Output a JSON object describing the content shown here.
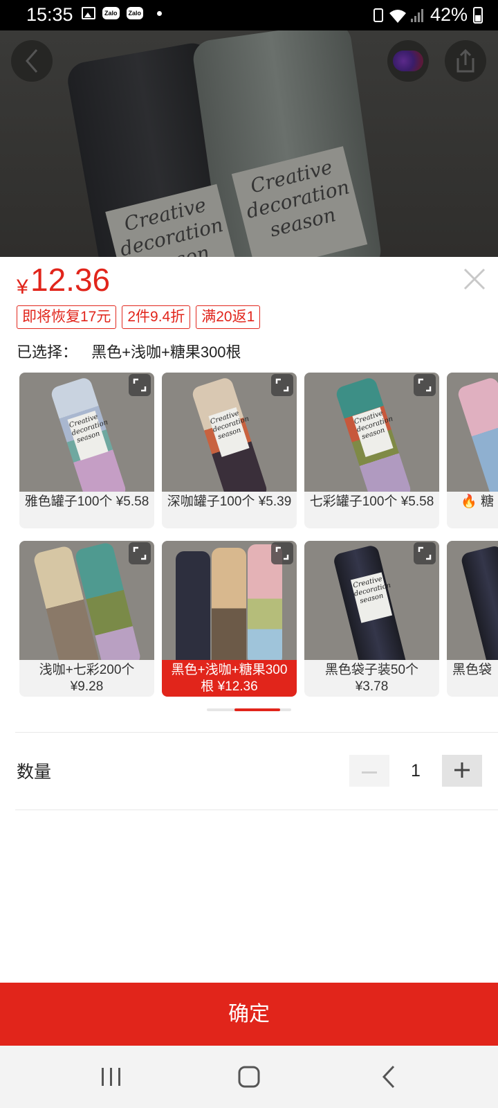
{
  "status_bar": {
    "time": "15:35",
    "notification_icons": [
      "image-icon",
      "zalo-icon",
      "zalo-icon",
      "dot-icon"
    ],
    "zalo_text": "Zalo",
    "battery": "42%"
  },
  "hero": {
    "label_text": "Creative decoration season"
  },
  "sheet": {
    "currency": "¥",
    "price": "12.36",
    "tags": [
      "即将恢复17元",
      "2件9.4折",
      "满20返1"
    ],
    "selected_label": "已选择：",
    "selected_value": "黑色+浅咖+糖果300根",
    "options": [
      {
        "caption": "雅色罐子100个 ¥5.58",
        "selected": false
      },
      {
        "caption": "深咖罐子100个 ¥5.39",
        "selected": false
      },
      {
        "caption": "七彩罐子100个 ¥5.58",
        "selected": false
      },
      {
        "caption": "糖",
        "selected": false
      },
      {
        "caption": "浅咖+七彩200个 ¥9.28",
        "selected": false
      },
      {
        "caption": "黑色+浅咖+糖果300根 ¥12.36",
        "selected": true
      },
      {
        "caption": "黑色袋子装50个 ¥3.78",
        "selected": false
      },
      {
        "caption": "黑色袋",
        "selected": false
      }
    ],
    "quantity_label": "数量",
    "quantity": "1",
    "confirm_label": "确定"
  },
  "colors": {
    "accent": "#e1251b",
    "sheet_bg": "#ffffff",
    "nav_bg": "#f3f3f3"
  }
}
